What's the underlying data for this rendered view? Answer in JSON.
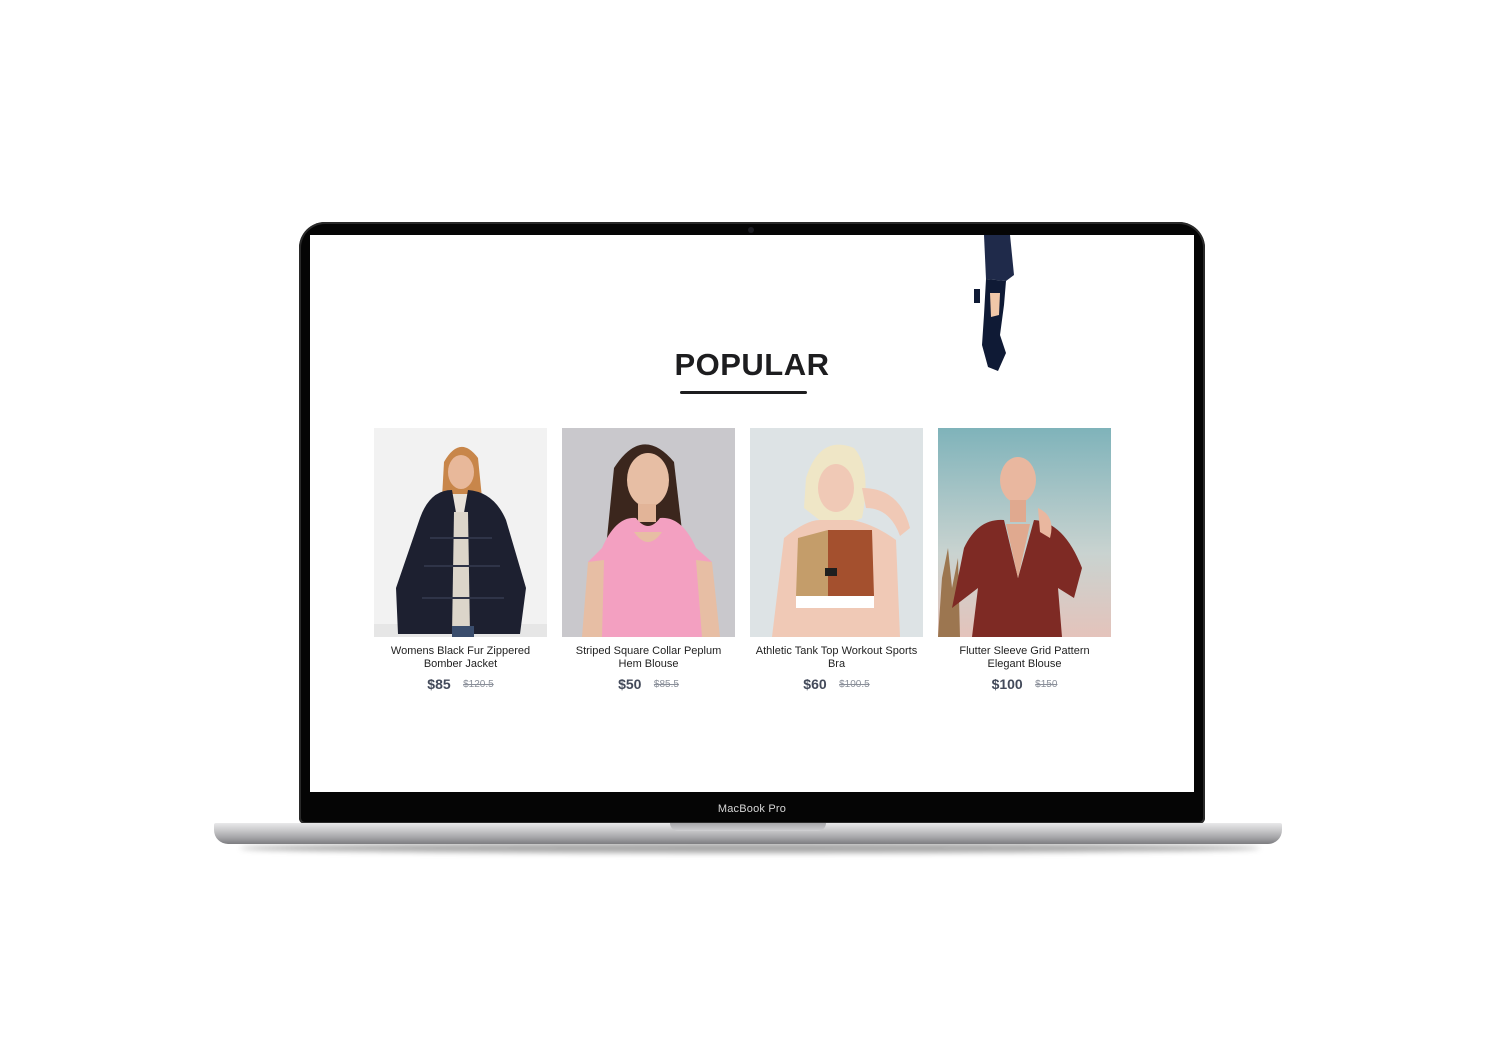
{
  "device": {
    "label": "MacBook Pro"
  },
  "section": {
    "title": "POPULAR"
  },
  "products": [
    {
      "name": "Womens Black Fur Zippered Bomber Jacket",
      "price": "$85",
      "old_price": "$120.5"
    },
    {
      "name": "Striped Square Collar Peplum Hem Blouse",
      "price": "$50",
      "old_price": "$85.5"
    },
    {
      "name": "Athletic Tank Top Workout Sports Bra",
      "price": "$60",
      "old_price": "$100.5"
    },
    {
      "name": "Flutter Sleeve Grid Pattern Elegant Blouse",
      "price": "$100",
      "old_price": "$150"
    }
  ],
  "colors": {
    "title": "#1d1d1f",
    "price": "#434a5a",
    "old_price": "#8a8f99"
  }
}
